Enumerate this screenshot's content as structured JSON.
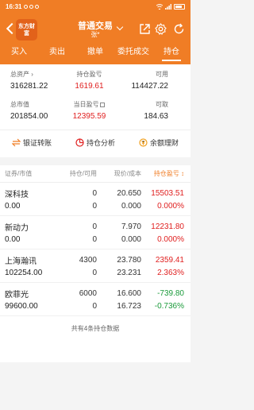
{
  "status_bar": {
    "time": "16:31"
  },
  "header": {
    "logo_text": "东方财富",
    "title": "普通交易",
    "subtitle": "张*"
  },
  "tabs": [
    "买入",
    "卖出",
    "撤单",
    "委托成交",
    "持仓"
  ],
  "summary": {
    "total_assets_label": "总资产",
    "total_assets": "316281.22",
    "position_pnl_label": "持仓盈亏",
    "position_pnl": "1619.61",
    "available_label": "可用",
    "available": "114427.22",
    "market_value_label": "总市值",
    "market_value": "201854.00",
    "today_pnl_label": "当日盈亏",
    "today_pnl": "12395.59",
    "withdrawable_label": "可取",
    "withdrawable": "184.63"
  },
  "quick_actions": {
    "transfer": "银证转账",
    "analysis": "持仓分析",
    "wealth": "余额理财"
  },
  "table": {
    "col_security": "证券/市值",
    "col_position": "持仓/可用",
    "col_price": "现价/成本",
    "col_pnl": "持仓盈亏",
    "rows": [
      {
        "name": "深科技",
        "market_value": "0.00",
        "position": "0",
        "available": "0",
        "price": "20.650",
        "cost": "0.000",
        "pnl": "15503.51",
        "pnl_pct": "0.000%",
        "color": "#e02020"
      },
      {
        "name": "新动力",
        "market_value": "0.00",
        "position": "0",
        "available": "0",
        "price": "7.970",
        "cost": "0.000",
        "pnl": "12231.80",
        "pnl_pct": "0.000%",
        "color": "#e02020"
      },
      {
        "name": "上海瀚讯",
        "market_value": "102254.00",
        "position": "4300",
        "available": "0",
        "price": "23.780",
        "cost": "23.231",
        "pnl": "2359.41",
        "pnl_pct": "2.363%",
        "color": "#e02020"
      },
      {
        "name": "欧菲光",
        "market_value": "99600.00",
        "position": "6000",
        "available": "0",
        "price": "16.600",
        "cost": "16.723",
        "pnl": "-739.80",
        "pnl_pct": "-0.736%",
        "color": "#1a9a3a"
      }
    ],
    "footer": "共有4条持仓数据"
  },
  "colors": {
    "brand": "#f07d25",
    "up": "#e02020",
    "down": "#1a9a3a"
  }
}
